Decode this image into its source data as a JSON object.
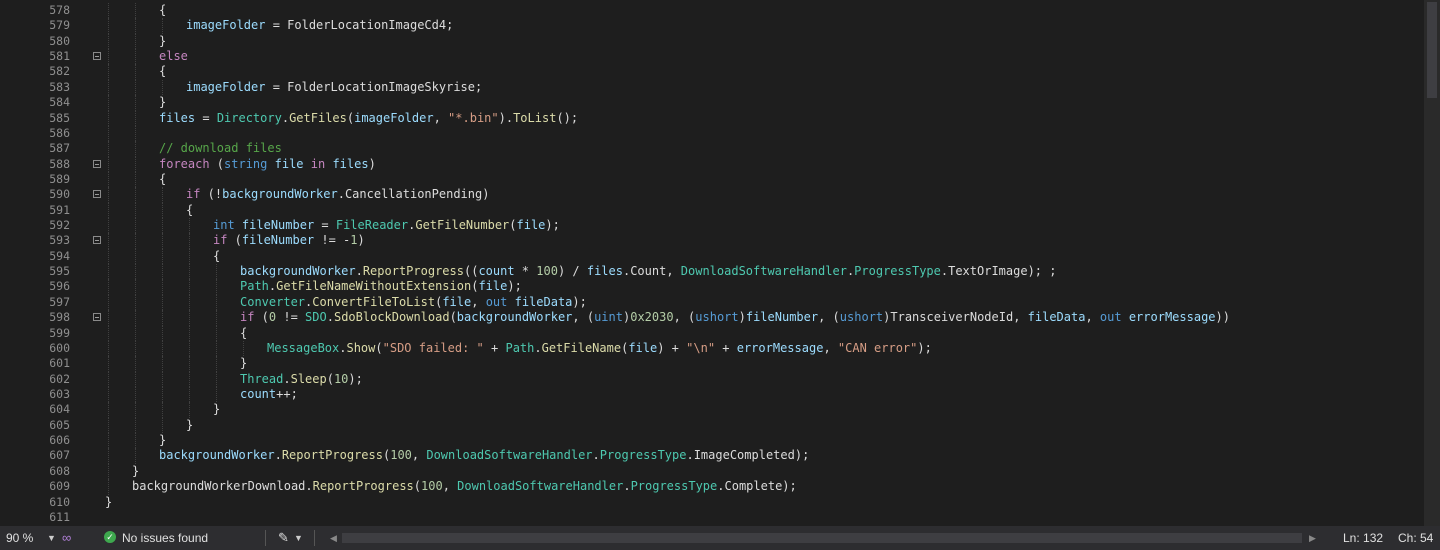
{
  "status": {
    "zoom": "90 %",
    "issues": "No issues found",
    "line_label": "Ln: 132",
    "col_label": "Ch: 54",
    "icons": [
      "chevron-down-icon",
      "visual-studio-icon",
      "check-circle-icon",
      "brush-icon",
      "arrow-left-icon",
      "arrow-right-icon"
    ]
  },
  "colors": {
    "keyword": "#569cd6",
    "control": "#c586c0",
    "type": "#4ec9b0",
    "method": "#dcdcaa",
    "variable": "#9cdcfe",
    "string": "#d69d85",
    "number": "#b5cea8",
    "comment": "#57a64a"
  },
  "code_lines": [
    {
      "num": "578",
      "fold": false,
      "indent": 3,
      "tokens": [
        [
          "p",
          "{"
        ]
      ]
    },
    {
      "num": "579",
      "fold": false,
      "indent": 4,
      "tokens": [
        [
          "v",
          "imageFolder"
        ],
        [
          "p",
          " = FolderLocationImageCd4;"
        ]
      ]
    },
    {
      "num": "580",
      "fold": false,
      "indent": 3,
      "tokens": [
        [
          "p",
          "}"
        ]
      ]
    },
    {
      "num": "581",
      "fold": true,
      "indent": 3,
      "tokens": [
        [
          "c",
          "else"
        ]
      ]
    },
    {
      "num": "582",
      "fold": false,
      "indent": 3,
      "tokens": [
        [
          "p",
          "{"
        ]
      ]
    },
    {
      "num": "583",
      "fold": false,
      "indent": 4,
      "tokens": [
        [
          "v",
          "imageFolder"
        ],
        [
          "p",
          " = FolderLocationImageSkyrise;"
        ]
      ]
    },
    {
      "num": "584",
      "fold": false,
      "indent": 3,
      "tokens": [
        [
          "p",
          "}"
        ]
      ]
    },
    {
      "num": "585",
      "fold": false,
      "indent": 3,
      "tokens": [
        [
          "v",
          "files"
        ],
        [
          "p",
          " = "
        ],
        [
          "t",
          "Directory"
        ],
        [
          "p",
          "."
        ],
        [
          "m",
          "GetFiles"
        ],
        [
          "p",
          "("
        ],
        [
          "v",
          "imageFolder"
        ],
        [
          "p",
          ", "
        ],
        [
          "s",
          "\"*.bin\""
        ],
        [
          "p",
          ")."
        ],
        [
          "m",
          "ToList"
        ],
        [
          "p",
          "();"
        ]
      ]
    },
    {
      "num": "586",
      "fold": false,
      "indent": 3,
      "tokens": []
    },
    {
      "num": "587",
      "fold": false,
      "indent": 3,
      "tokens": [
        [
          "cm",
          "// download files"
        ]
      ]
    },
    {
      "num": "588",
      "fold": true,
      "indent": 3,
      "tokens": [
        [
          "c",
          "foreach"
        ],
        [
          "p",
          " ("
        ],
        [
          "k",
          "string"
        ],
        [
          "p",
          " "
        ],
        [
          "v",
          "file"
        ],
        [
          "p",
          " "
        ],
        [
          "c",
          "in"
        ],
        [
          "p",
          " "
        ],
        [
          "v",
          "files"
        ],
        [
          "p",
          ")"
        ]
      ]
    },
    {
      "num": "589",
      "fold": false,
      "indent": 3,
      "tokens": [
        [
          "p",
          "{"
        ]
      ]
    },
    {
      "num": "590",
      "fold": true,
      "indent": 4,
      "tokens": [
        [
          "c",
          "if"
        ],
        [
          "p",
          " (!"
        ],
        [
          "v",
          "backgroundWorker"
        ],
        [
          "p",
          ".CancellationPending)"
        ]
      ]
    },
    {
      "num": "591",
      "fold": false,
      "indent": 4,
      "tokens": [
        [
          "p",
          "{"
        ]
      ]
    },
    {
      "num": "592",
      "fold": false,
      "indent": 5,
      "tokens": [
        [
          "k",
          "int"
        ],
        [
          "p",
          " "
        ],
        [
          "v",
          "fileNumber"
        ],
        [
          "p",
          " = "
        ],
        [
          "t",
          "FileReader"
        ],
        [
          "p",
          "."
        ],
        [
          "m",
          "GetFileNumber"
        ],
        [
          "p",
          "("
        ],
        [
          "v",
          "file"
        ],
        [
          "p",
          ");"
        ]
      ]
    },
    {
      "num": "593",
      "fold": true,
      "indent": 5,
      "tokens": [
        [
          "c",
          "if"
        ],
        [
          "p",
          " ("
        ],
        [
          "v",
          "fileNumber"
        ],
        [
          "p",
          " != -"
        ],
        [
          "n",
          "1"
        ],
        [
          "p",
          ")"
        ]
      ]
    },
    {
      "num": "594",
      "fold": false,
      "indent": 5,
      "tokens": [
        [
          "p",
          "{"
        ]
      ]
    },
    {
      "num": "595",
      "fold": false,
      "indent": 6,
      "tokens": [
        [
          "v",
          "backgroundWorker"
        ],
        [
          "p",
          "."
        ],
        [
          "m",
          "ReportProgress"
        ],
        [
          "p",
          "(("
        ],
        [
          "v",
          "count"
        ],
        [
          "p",
          " * "
        ],
        [
          "n",
          "100"
        ],
        [
          "p",
          ") / "
        ],
        [
          "v",
          "files"
        ],
        [
          "p",
          ".Count, "
        ],
        [
          "t",
          "DownloadSoftwareHandler"
        ],
        [
          "p",
          "."
        ],
        [
          "t",
          "ProgressType"
        ],
        [
          "p",
          ".TextOrImage); ;"
        ]
      ]
    },
    {
      "num": "596",
      "fold": false,
      "indent": 6,
      "tokens": [
        [
          "t",
          "Path"
        ],
        [
          "p",
          "."
        ],
        [
          "m",
          "GetFileNameWithoutExtension"
        ],
        [
          "p",
          "("
        ],
        [
          "v",
          "file"
        ],
        [
          "p",
          ");"
        ]
      ]
    },
    {
      "num": "597",
      "fold": false,
      "indent": 6,
      "tokens": [
        [
          "t",
          "Converter"
        ],
        [
          "p",
          "."
        ],
        [
          "m",
          "ConvertFileToList"
        ],
        [
          "p",
          "("
        ],
        [
          "v",
          "file"
        ],
        [
          "p",
          ", "
        ],
        [
          "k",
          "out"
        ],
        [
          "p",
          " "
        ],
        [
          "v",
          "fileData"
        ],
        [
          "p",
          ");"
        ]
      ]
    },
    {
      "num": "598",
      "fold": true,
      "indent": 6,
      "tokens": [
        [
          "c",
          "if"
        ],
        [
          "p",
          " ("
        ],
        [
          "n",
          "0"
        ],
        [
          "p",
          " != "
        ],
        [
          "t",
          "SDO"
        ],
        [
          "p",
          "."
        ],
        [
          "m",
          "SdoBlockDownload"
        ],
        [
          "p",
          "("
        ],
        [
          "v",
          "backgroundWorker"
        ],
        [
          "p",
          ", ("
        ],
        [
          "k",
          "uint"
        ],
        [
          "p",
          ")"
        ],
        [
          "n",
          "0x2030"
        ],
        [
          "p",
          ", ("
        ],
        [
          "k",
          "ushort"
        ],
        [
          "p",
          ")"
        ],
        [
          "v",
          "fileNumber"
        ],
        [
          "p",
          ", ("
        ],
        [
          "k",
          "ushort"
        ],
        [
          "p",
          ")TransceiverNodeId, "
        ],
        [
          "v",
          "fileData"
        ],
        [
          "p",
          ", "
        ],
        [
          "k",
          "out"
        ],
        [
          "p",
          " "
        ],
        [
          "v",
          "errorMessage"
        ],
        [
          "p",
          "))"
        ]
      ]
    },
    {
      "num": "599",
      "fold": false,
      "indent": 6,
      "tokens": [
        [
          "p",
          "{"
        ]
      ]
    },
    {
      "num": "600",
      "fold": false,
      "indent": 7,
      "tokens": [
        [
          "t",
          "MessageBox"
        ],
        [
          "p",
          "."
        ],
        [
          "m",
          "Show"
        ],
        [
          "p",
          "("
        ],
        [
          "s",
          "\"SDO failed: \""
        ],
        [
          "p",
          " + "
        ],
        [
          "t",
          "Path"
        ],
        [
          "p",
          "."
        ],
        [
          "m",
          "GetFileName"
        ],
        [
          "p",
          "("
        ],
        [
          "v",
          "file"
        ],
        [
          "p",
          ") + "
        ],
        [
          "s",
          "\"\\n\""
        ],
        [
          "p",
          " + "
        ],
        [
          "v",
          "errorMessage"
        ],
        [
          "p",
          ", "
        ],
        [
          "s",
          "\"CAN error\""
        ],
        [
          "p",
          ");"
        ]
      ]
    },
    {
      "num": "601",
      "fold": false,
      "indent": 6,
      "tokens": [
        [
          "p",
          "}"
        ]
      ]
    },
    {
      "num": "602",
      "fold": false,
      "indent": 6,
      "tokens": [
        [
          "t",
          "Thread"
        ],
        [
          "p",
          "."
        ],
        [
          "m",
          "Sleep"
        ],
        [
          "p",
          "("
        ],
        [
          "n",
          "10"
        ],
        [
          "p",
          ");"
        ]
      ]
    },
    {
      "num": "603",
      "fold": false,
      "indent": 6,
      "tokens": [
        [
          "v",
          "count"
        ],
        [
          "p",
          "++;"
        ]
      ]
    },
    {
      "num": "604",
      "fold": false,
      "indent": 5,
      "tokens": [
        [
          "p",
          "}"
        ]
      ]
    },
    {
      "num": "605",
      "fold": false,
      "indent": 4,
      "tokens": [
        [
          "p",
          "}"
        ]
      ]
    },
    {
      "num": "606",
      "fold": false,
      "indent": 3,
      "tokens": [
        [
          "p",
          "}"
        ]
      ]
    },
    {
      "num": "607",
      "fold": false,
      "indent": 3,
      "tokens": [
        [
          "v",
          "backgroundWorker"
        ],
        [
          "p",
          "."
        ],
        [
          "m",
          "ReportProgress"
        ],
        [
          "p",
          "("
        ],
        [
          "n",
          "100"
        ],
        [
          "p",
          ", "
        ],
        [
          "t",
          "DownloadSoftwareHandler"
        ],
        [
          "p",
          "."
        ],
        [
          "t",
          "ProgressType"
        ],
        [
          "p",
          ".ImageCompleted);"
        ]
      ]
    },
    {
      "num": "608",
      "fold": false,
      "indent": 2,
      "tokens": [
        [
          "p",
          "}"
        ]
      ]
    },
    {
      "num": "609",
      "fold": false,
      "indent": 2,
      "tokens": [
        [
          "p",
          "backgroundWorkerDownload."
        ],
        [
          "m",
          "ReportProgress"
        ],
        [
          "p",
          "("
        ],
        [
          "n",
          "100"
        ],
        [
          "p",
          ", "
        ],
        [
          "t",
          "DownloadSoftwareHandler"
        ],
        [
          "p",
          "."
        ],
        [
          "t",
          "ProgressType"
        ],
        [
          "p",
          ".Complete);"
        ]
      ]
    },
    {
      "num": "610",
      "fold": false,
      "indent": 1,
      "tokens": [
        [
          "p",
          "}"
        ]
      ]
    },
    {
      "num": "611",
      "fold": false,
      "indent": 1,
      "tokens": []
    }
  ]
}
